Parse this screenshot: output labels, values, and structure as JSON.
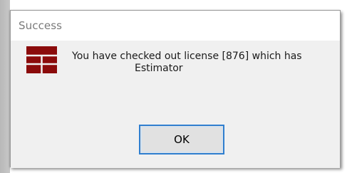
{
  "dialog": {
    "title": "Success",
    "message_line1": "You have checked out license [876] which has",
    "message_line2": "Estimator",
    "ok_label": "OK",
    "icon": "app-logo-icon"
  },
  "colors": {
    "icon_red": "#8b0b0b",
    "button_border": "#2f7fd0",
    "dialog_bg": "#f0f0f0",
    "titlebar_bg": "#ffffff"
  }
}
